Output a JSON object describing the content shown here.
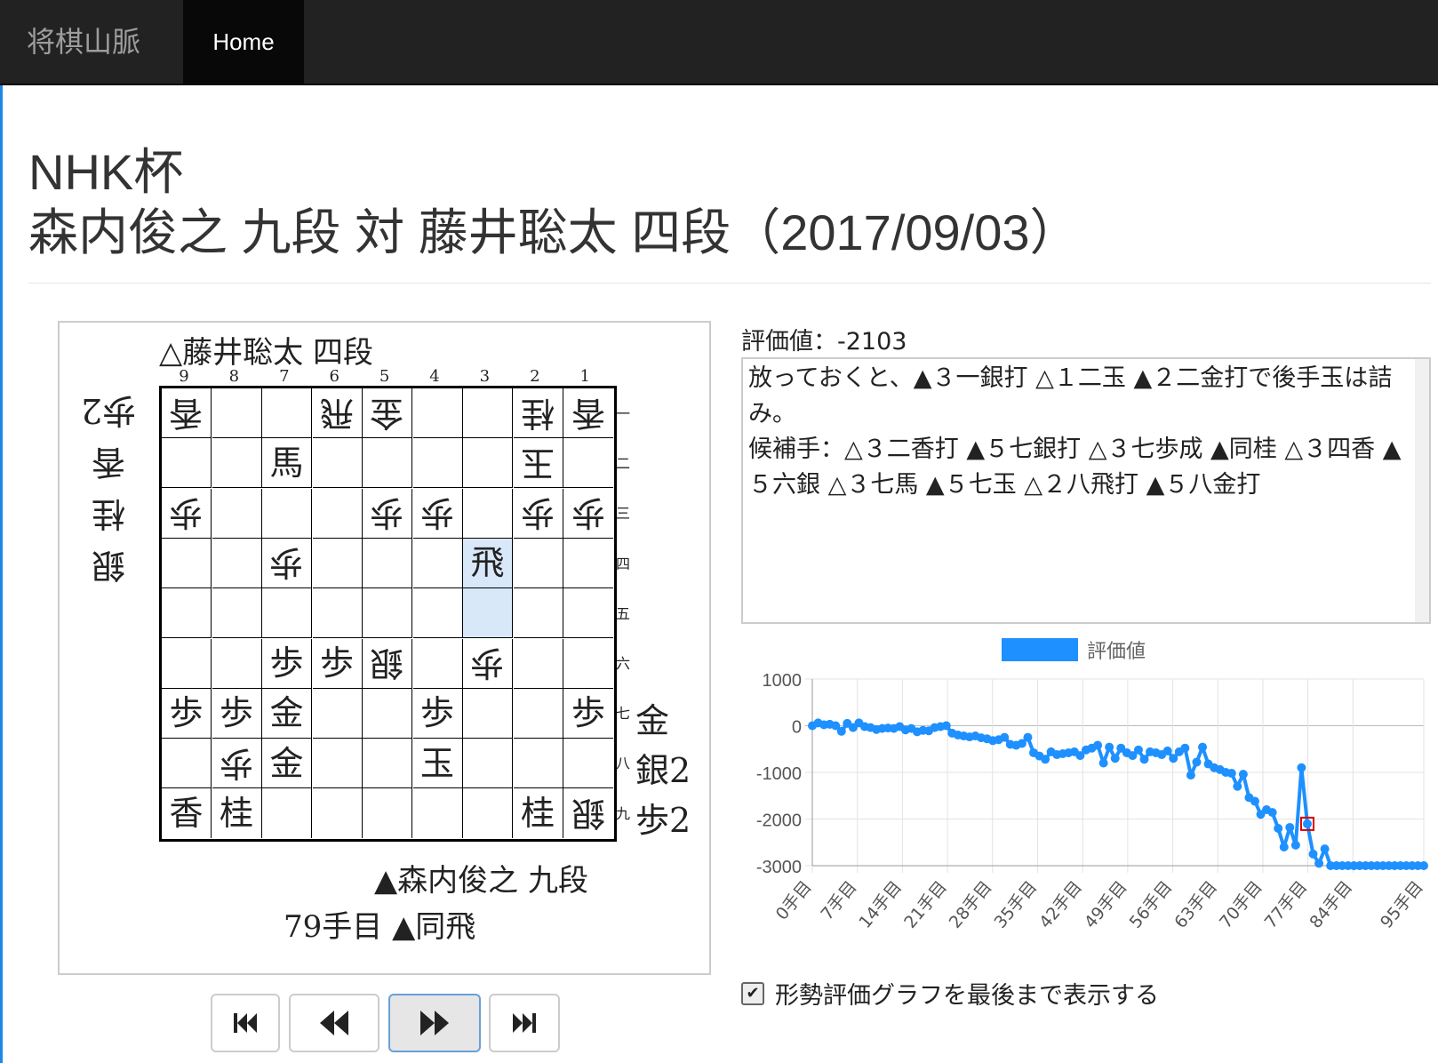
{
  "navbar": {
    "brand": "将棋山脈",
    "home_label": "Home"
  },
  "title": {
    "line1": "NHK杯",
    "line2": "森内俊之 九段 対 藤井聡太 四段（2017/09/03）"
  },
  "board": {
    "gote_player": "△藤井聡太 四段",
    "sente_player": "▲森内俊之 九段",
    "move_label": "79手目 ▲同飛",
    "file_numbers": [
      "9",
      "8",
      "7",
      "6",
      "5",
      "4",
      "3",
      "2",
      "1"
    ],
    "rank_numbers": [
      "一",
      "二",
      "三",
      "四",
      "五",
      "六",
      "七",
      "八",
      "九"
    ],
    "gote_hand": [
      "歩2",
      "香",
      "桂",
      "銀"
    ],
    "sente_hand": [
      "金",
      "銀2",
      "歩2"
    ],
    "rows": [
      [
        {
          "p": "香",
          "g": true
        },
        {
          "p": "",
          "g": false
        },
        {
          "p": "",
          "g": false
        },
        {
          "p": "飛",
          "g": true
        },
        {
          "p": "金",
          "g": true
        },
        {
          "p": "",
          "g": false
        },
        {
          "p": "",
          "g": false
        },
        {
          "p": "桂",
          "g": true
        },
        {
          "p": "香",
          "g": true
        }
      ],
      [
        {
          "p": "",
          "g": false
        },
        {
          "p": "",
          "g": false
        },
        {
          "p": "馬",
          "g": false
        },
        {
          "p": "",
          "g": false
        },
        {
          "p": "",
          "g": false
        },
        {
          "p": "",
          "g": false
        },
        {
          "p": "",
          "g": false
        },
        {
          "p": "玉",
          "g": true
        },
        {
          "p": "",
          "g": false
        }
      ],
      [
        {
          "p": "歩",
          "g": true
        },
        {
          "p": "",
          "g": false
        },
        {
          "p": "",
          "g": false
        },
        {
          "p": "",
          "g": false
        },
        {
          "p": "歩",
          "g": true
        },
        {
          "p": "歩",
          "g": true
        },
        {
          "p": "",
          "g": false
        },
        {
          "p": "歩",
          "g": true
        },
        {
          "p": "歩",
          "g": true
        }
      ],
      [
        {
          "p": "",
          "g": false
        },
        {
          "p": "",
          "g": false
        },
        {
          "p": "歩",
          "g": true
        },
        {
          "p": "",
          "g": false
        },
        {
          "p": "",
          "g": false
        },
        {
          "p": "",
          "g": false
        },
        {
          "p": "飛",
          "g": false,
          "hl": true
        },
        {
          "p": "",
          "g": false
        },
        {
          "p": "",
          "g": false
        }
      ],
      [
        {
          "p": "",
          "g": false
        },
        {
          "p": "",
          "g": false
        },
        {
          "p": "",
          "g": false
        },
        {
          "p": "",
          "g": false
        },
        {
          "p": "",
          "g": false
        },
        {
          "p": "",
          "g": false
        },
        {
          "p": "",
          "g": false,
          "hl": true
        },
        {
          "p": "",
          "g": false
        },
        {
          "p": "",
          "g": false
        }
      ],
      [
        {
          "p": "",
          "g": false
        },
        {
          "p": "",
          "g": false
        },
        {
          "p": "歩",
          "g": false
        },
        {
          "p": "歩",
          "g": false
        },
        {
          "p": "銀",
          "g": true
        },
        {
          "p": "",
          "g": false
        },
        {
          "p": "歩",
          "g": true
        },
        {
          "p": "",
          "g": false
        },
        {
          "p": "",
          "g": false
        }
      ],
      [
        {
          "p": "歩",
          "g": false
        },
        {
          "p": "歩",
          "g": false
        },
        {
          "p": "金",
          "g": false
        },
        {
          "p": "",
          "g": false
        },
        {
          "p": "",
          "g": false
        },
        {
          "p": "歩",
          "g": false
        },
        {
          "p": "",
          "g": false
        },
        {
          "p": "",
          "g": false
        },
        {
          "p": "歩",
          "g": false
        }
      ],
      [
        {
          "p": "",
          "g": false
        },
        {
          "p": "歩",
          "g": true
        },
        {
          "p": "金",
          "g": false
        },
        {
          "p": "",
          "g": false
        },
        {
          "p": "",
          "g": false
        },
        {
          "p": "玉",
          "g": false
        },
        {
          "p": "",
          "g": false
        },
        {
          "p": "",
          "g": false
        },
        {
          "p": "",
          "g": false
        }
      ],
      [
        {
          "p": "香",
          "g": false
        },
        {
          "p": "桂",
          "g": false
        },
        {
          "p": "",
          "g": false
        },
        {
          "p": "",
          "g": false
        },
        {
          "p": "",
          "g": false
        },
        {
          "p": "",
          "g": false
        },
        {
          "p": "",
          "g": false
        },
        {
          "p": "桂",
          "g": false
        },
        {
          "p": "銀",
          "g": true
        }
      ]
    ]
  },
  "controls": {
    "icons": [
      "skip-to-start-icon",
      "step-backward-icon",
      "step-forward-icon",
      "skip-to-end-icon"
    ]
  },
  "analysis": {
    "eval_text": "評価値：-2103",
    "comment_line1": "放っておくと、▲３一銀打 △１二玉 ▲２二金打で後手玉は詰み。",
    "comment_line2": "候補手：△３二香打 ▲５七銀打 △３七歩成 ▲同桂 △３四香 ▲５六銀 △３七馬 ▲５七玉 △２八飛打 ▲５八金打",
    "checkbox_label": "形勢評価グラフを最後まで表示する",
    "checkbox_checked": true
  },
  "chart_data": {
    "type": "line",
    "legend": "評価値",
    "legend_position": "top",
    "color": "#1e90ff",
    "ylim": [
      -3000,
      1000
    ],
    "yticks": [
      1000,
      0,
      -1000,
      -2000,
      -3000
    ],
    "xtick_labels": [
      "0手目",
      "7手目",
      "14手目",
      "21手目",
      "28手目",
      "35手目",
      "42手目",
      "49手目",
      "56手目",
      "63手目",
      "70手目",
      "77手目",
      "84手目",
      "95手目"
    ],
    "xtick_positions": [
      0,
      7,
      14,
      21,
      28,
      35,
      42,
      49,
      56,
      63,
      70,
      77,
      84,
      95
    ],
    "current_index": 79,
    "values": [
      0,
      60,
      20,
      30,
      0,
      -120,
      50,
      -40,
      60,
      -20,
      -40,
      -80,
      -60,
      -50,
      -60,
      -20,
      -90,
      -60,
      -130,
      -100,
      -110,
      -40,
      -20,
      0,
      -160,
      -200,
      -220,
      -240,
      -220,
      -260,
      -280,
      -320,
      -300,
      -250,
      -400,
      -420,
      -380,
      -250,
      -580,
      -650,
      -720,
      -560,
      -620,
      -600,
      -580,
      -560,
      -640,
      -520,
      -480,
      -420,
      -800,
      -460,
      -700,
      -480,
      -580,
      -640,
      -520,
      -720,
      -560,
      -580,
      -620,
      -540,
      -700,
      -560,
      -480,
      -1060,
      -780,
      -460,
      -820,
      -900,
      -940,
      -1000,
      -1020,
      -1300,
      -1040,
      -1540,
      -1620,
      -1900,
      -1800,
      -1860,
      -2200,
      -2600,
      -2180,
      -2560,
      -900,
      -2103,
      -2750,
      -2950,
      -2640,
      -3000,
      -3000,
      -3000,
      -3000,
      -3000,
      -3000,
      -3000,
      -3000,
      -3000,
      -3000,
      -3000,
      -3000,
      -3000,
      -3000,
      -3000,
      -3000,
      -3000
    ]
  }
}
